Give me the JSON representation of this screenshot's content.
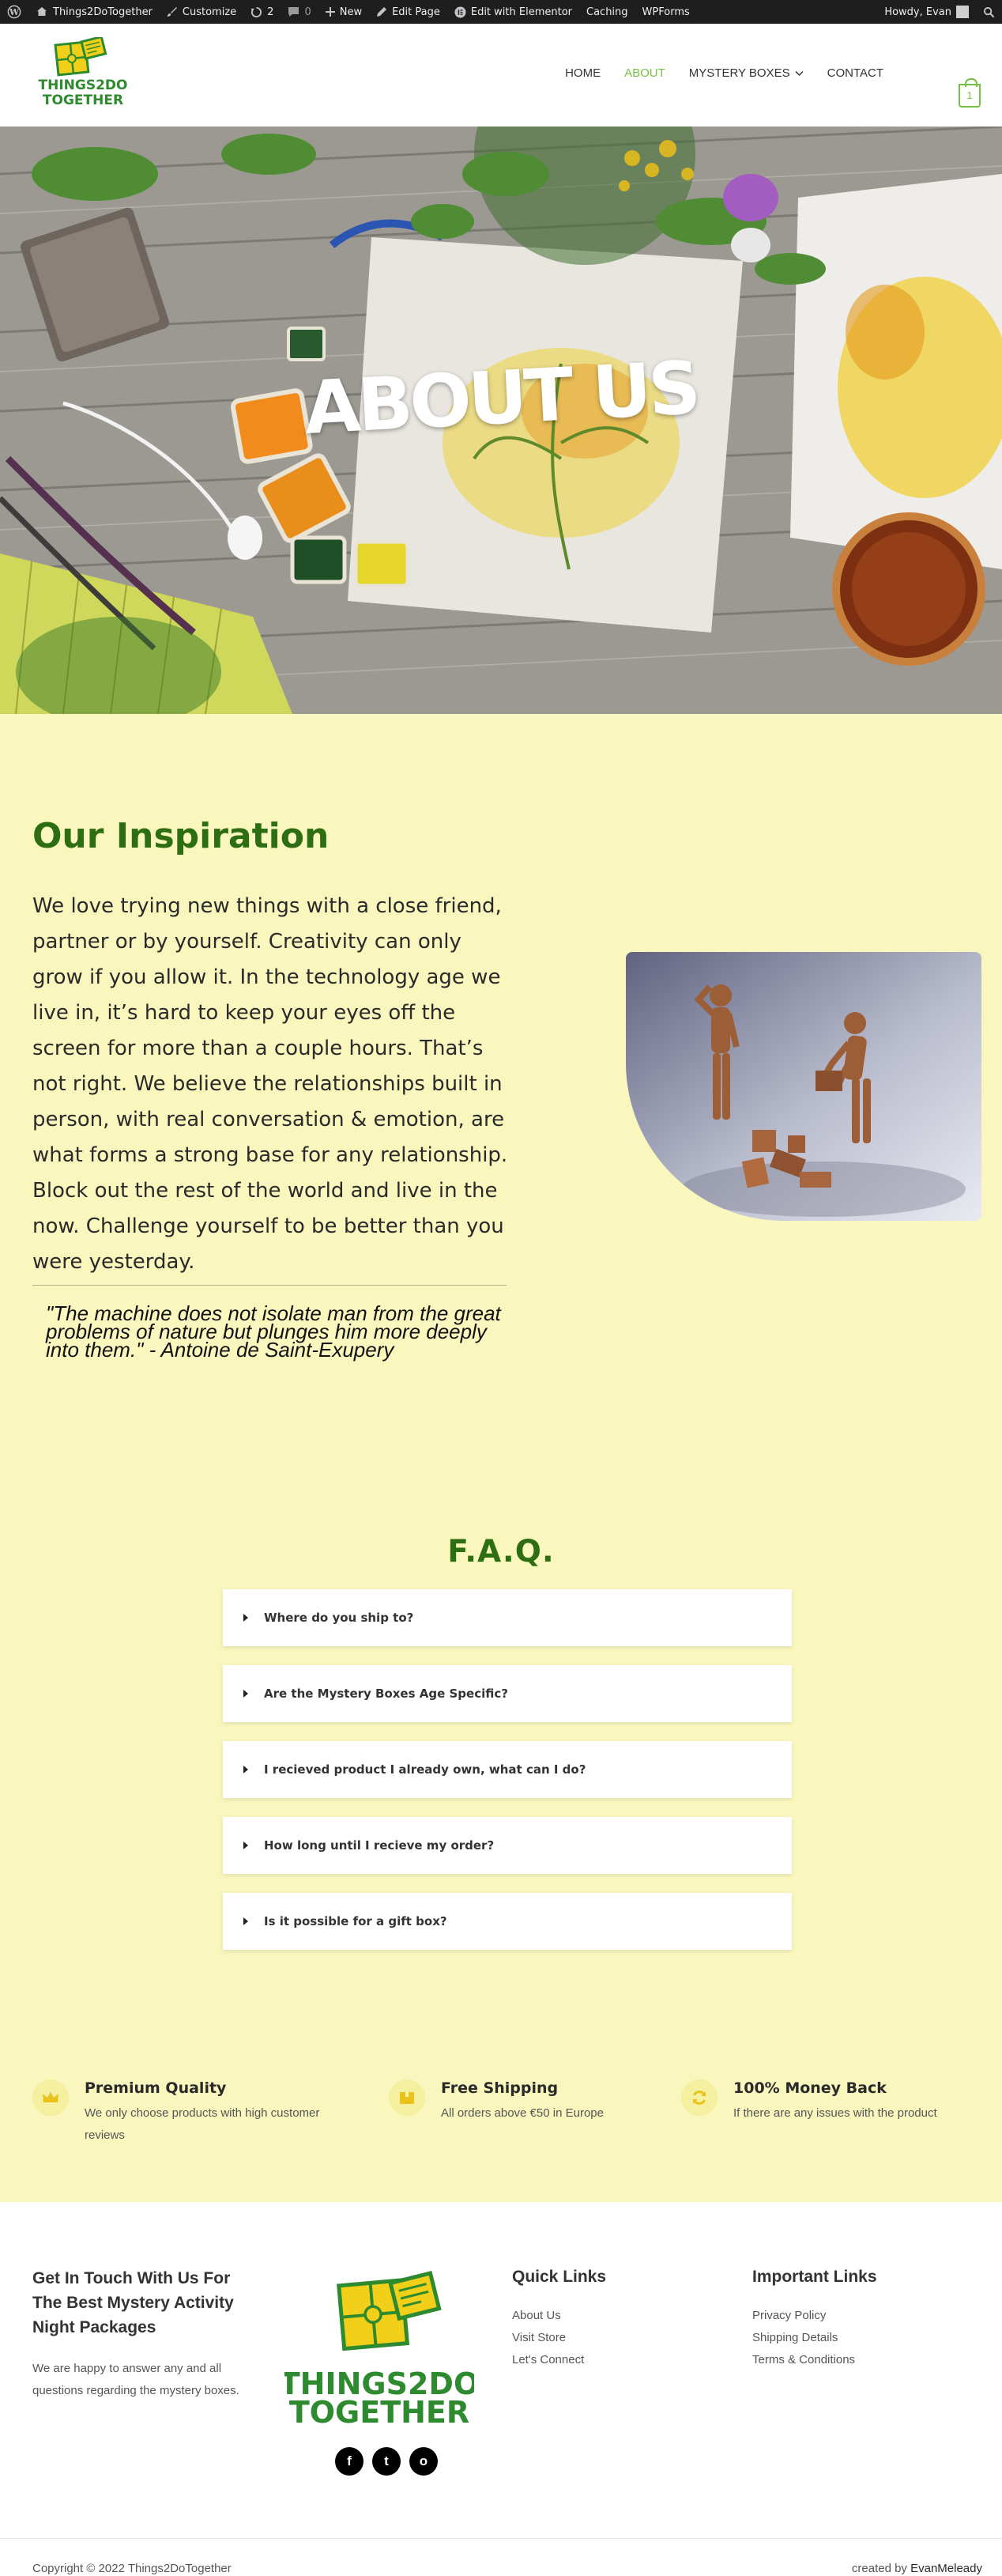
{
  "admin_bar": {
    "site_name": "Things2DoTogether",
    "customize": "Customize",
    "updates": "2",
    "comments": "0",
    "new": "New",
    "edit_page": "Edit Page",
    "edit_elementor": "Edit with Elementor",
    "caching": "Caching",
    "wpforms": "WPForms",
    "howdy": "Howdy, Evan"
  },
  "brand": {
    "logo_line1": "THINGS2DO",
    "logo_line2": "TOGETHER",
    "logo_digit": "2",
    "green": "#2d8a2e",
    "yellow": "#f2d01a"
  },
  "nav": {
    "home": "HOME",
    "about": "ABOUT",
    "mystery_boxes": "MYSTERY BOXES",
    "contact": "CONTACT",
    "cart_count": "1"
  },
  "hero": {
    "title": "ABOUT US"
  },
  "inspiration": {
    "title": "Our Inspiration",
    "body": "We love trying new things with a close friend, partner or by yourself. Creativity can only grow if you allow it. In the technology age we live in, it’s hard to keep your eyes off the screen for more than a couple hours. That’s not right. We believe the relationships built in person, with real conversation & emotion, are what forms a strong base for any relationship. Block out the rest of the world and live in the now. Challenge yourself to be better than you were yesterday.",
    "quote": "\"The machine does not isolate man from the great problems of nature but plunges him more deeply into them.\" - Antoine de Saint-Exupery"
  },
  "faq": {
    "title": "F.A.Q.",
    "items": [
      "Where do you ship to?",
      "Are the Mystery Boxes Age Specific?",
      "I recieved product I already own, what can I do?",
      "How long until I recieve my order?",
      "Is it possible for a gift box?"
    ]
  },
  "features": [
    {
      "title": "Premium Quality",
      "text": "We only choose products with high customer reviews",
      "icon": "crown-icon"
    },
    {
      "title": "Free Shipping",
      "text": "All orders above €50 in Europe",
      "icon": "box-icon"
    },
    {
      "title": "100% Money Back",
      "text": "If there are any issues with the product",
      "icon": "refresh-icon"
    }
  ],
  "footer": {
    "contact_heading": "Get In Touch With Us For The Best Mystery Activity Night Packages",
    "contact_text": "We are happy to answer any and all questions regarding the mystery boxes.",
    "social": {
      "facebook": "f",
      "twitter": "t",
      "instagram": "o"
    },
    "quick_links_title": "Quick Links",
    "quick_links": [
      "About Us",
      "Visit Store",
      "Let's Connect"
    ],
    "important_links_title": "Important Links",
    "important_links": [
      "Privacy Policy",
      "Shipping Details",
      "Terms & Conditions"
    ],
    "copyright": "Copyright © 2022 Things2DoTogether",
    "credit_prefix": "created by ",
    "credit_name": "EvanMeleady"
  }
}
